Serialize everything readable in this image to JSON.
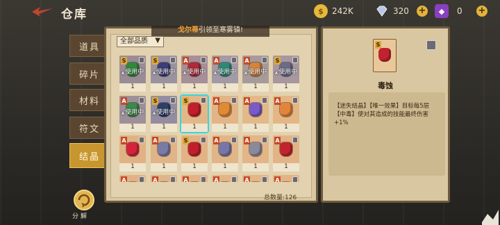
{
  "header": {
    "title": "仓库",
    "gold": "242K",
    "diamond": "320",
    "ticket": "0"
  },
  "tabs": [
    {
      "label": "道具",
      "active": false
    },
    {
      "label": "碎片",
      "active": false
    },
    {
      "label": "材料",
      "active": false
    },
    {
      "label": "符文",
      "active": false
    },
    {
      "label": "结晶",
      "active": true
    }
  ],
  "notice": {
    "highlight": "戈尔蒂",
    "text": "引领至寒雾镇!"
  },
  "filter": {
    "selected": "全部品质"
  },
  "grid": {
    "cards": [
      {
        "row": 0,
        "col": 0,
        "badge": "S",
        "bg": "#9a8c96",
        "gem": "#2f8a3a",
        "used": true,
        "count": "1"
      },
      {
        "row": 0,
        "col": 1,
        "badge": "S",
        "bg": "#9b92a0",
        "gem": "#3d3d7a",
        "used": true,
        "count": "1"
      },
      {
        "row": 0,
        "col": 2,
        "badge": "A",
        "bg": "#a68f98",
        "gem": "#b0283a",
        "used": true,
        "count": "1"
      },
      {
        "row": 0,
        "col": 3,
        "badge": "A",
        "bg": "#a29aa6",
        "gem": "#2e8a78",
        "used": true,
        "count": "1"
      },
      {
        "row": 0,
        "col": 4,
        "badge": "A",
        "bg": "#a79a9a",
        "gem": "#d7833a",
        "used": true,
        "count": "1"
      },
      {
        "row": 0,
        "col": 5,
        "badge": "S",
        "bg": "#a7979f",
        "gem": "#6c6c88",
        "used": true,
        "count": "1"
      },
      {
        "row": 1,
        "col": 0,
        "badge": "A",
        "bg": "#9d9098",
        "gem": "#3a8a4a",
        "used": true,
        "count": "1"
      },
      {
        "row": 1,
        "col": 1,
        "badge": "S",
        "bg": "#948da2",
        "gem": "#2d3f6a",
        "used": true,
        "count": "1"
      },
      {
        "row": 1,
        "col": 2,
        "badge": "S",
        "bg": "#e3b788",
        "gem": "#c21f2b",
        "used": false,
        "count": "1",
        "selected": true
      },
      {
        "row": 1,
        "col": 3,
        "badge": "A",
        "bg": "#e2b486",
        "gem": "#e08a34",
        "used": false,
        "count": "1"
      },
      {
        "row": 1,
        "col": 4,
        "badge": "A",
        "bg": "#e3b98a",
        "gem": "#7a5ac6",
        "used": false,
        "count": "1"
      },
      {
        "row": 1,
        "col": 5,
        "badge": "A",
        "bg": "#e4b685",
        "gem": "#e2853a",
        "used": false,
        "count": "1"
      },
      {
        "row": 2,
        "col": 0,
        "badge": "A",
        "bg": "#e1b285",
        "gem": "#d4243a",
        "used": false,
        "count": "1"
      },
      {
        "row": 2,
        "col": 1,
        "badge": "A",
        "bg": "#e0b487",
        "gem": "#7a7aa6",
        "used": false,
        "count": "1"
      },
      {
        "row": 2,
        "col": 2,
        "badge": "S",
        "bg": "#e3b386",
        "gem": "#c01f2a",
        "used": false,
        "count": "1"
      },
      {
        "row": 2,
        "col": 3,
        "badge": "A",
        "bg": "#e2b586",
        "gem": "#7676a8",
        "used": false,
        "count": "1"
      },
      {
        "row": 2,
        "col": 4,
        "badge": "A",
        "bg": "#e3b587",
        "gem": "#8a8a9a",
        "used": false,
        "count": "1"
      },
      {
        "row": 2,
        "col": 5,
        "badge": "A",
        "bg": "#e3b386",
        "gem": "#c2242e",
        "used": false,
        "count": "1"
      },
      {
        "row": 3,
        "col": 0,
        "badge": "A",
        "bg": "#e1b285",
        "gem": "#c4263a",
        "used": false,
        "count": ""
      },
      {
        "row": 3,
        "col": 1,
        "badge": "A",
        "bg": "#e0b487",
        "gem": "#c4263a",
        "used": false,
        "count": ""
      },
      {
        "row": 3,
        "col": 2,
        "badge": "A",
        "bg": "#e3b386",
        "gem": "#c4263a",
        "used": false,
        "count": ""
      },
      {
        "row": 3,
        "col": 3,
        "badge": "A",
        "bg": "#e2b586",
        "gem": "#c4263a",
        "used": false,
        "count": ""
      },
      {
        "row": 3,
        "col": 4,
        "badge": "A",
        "bg": "#e3b587",
        "gem": "#c4263a",
        "used": false,
        "count": ""
      },
      {
        "row": 3,
        "col": 5,
        "badge": "A",
        "bg": "#e3b386",
        "gem": "#c4263a",
        "used": false,
        "count": ""
      }
    ],
    "used_label": "使用中",
    "total_label": "总数量:126"
  },
  "detail": {
    "badge": "S",
    "name": "毒蚀",
    "description": "【迷失结晶】【唯一效果】目标每5层【中毒】使对其造成的技能最终伤害+1%"
  },
  "decompose": {
    "label": "分解"
  },
  "icons": {
    "gold": "gold-coin-icon",
    "diamond": "diamond-icon",
    "ticket": "ticket-icon",
    "back": "back-arrow-icon",
    "lock": "lock-icon"
  },
  "colors": {
    "accent": "#c8962e",
    "selection": "#36d6e2"
  }
}
